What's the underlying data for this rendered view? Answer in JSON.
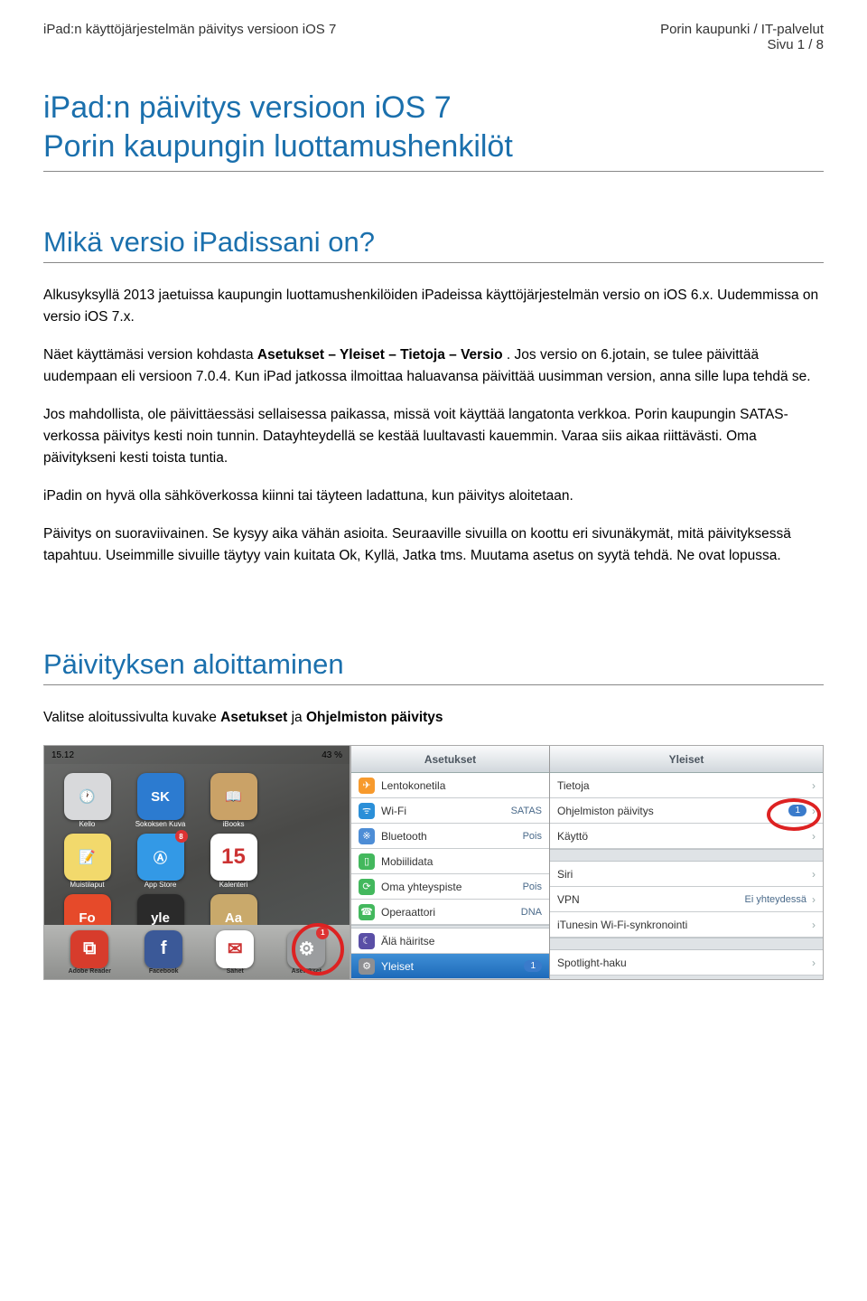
{
  "header": {
    "left": "iPad:n käyttöjärjestelmän päivitys versioon iOS 7",
    "right1": "Porin kaupunki / IT-palvelut",
    "right2": "Sivu 1 / 8"
  },
  "title1": "iPad:n päivitys versioon iOS 7",
  "title2": "Porin kaupungin luottamushenkilöt",
  "section1_title": "Mikä versio iPadissani on?",
  "p1a": "Alkusyksyllä 2013 jaetuissa kaupungin luottamushenkilöiden iPadeissa käyttöjärjestelmän versio on iOS 6.x. Uudemmissa on versio iOS 7.x.",
  "p1b_prefix": "Näet käyttämäsi version kohdasta ",
  "p1b_bold": "Asetukset – Yleiset – Tietoja – Versio",
  "p1b_suffix": ". Jos versio on 6.jotain, se tulee päivittää uudempaan eli versioon 7.0.4. Kun iPad jatkossa ilmoittaa haluavansa päivittää uusimman version, anna sille lupa tehdä se.",
  "p2": "Jos mahdollista, ole päivittäessäsi sellaisessa paikassa, missä voit käyttää langatonta verkkoa. Porin kaupungin SATAS-verkossa päivitys kesti noin tunnin. Datayhteydellä se kestää luultavasti kauemmin. Varaa siis aikaa riittävästi. Oma päivitykseni kesti toista tuntia.",
  "p3": "iPadin on hyvä olla sähköverkossa kiinni tai täyteen ladattuna, kun päivitys aloitetaan.",
  "p4": "Päivitys on suoraviivainen. Se kysyy aika vähän asioita. Seuraaville sivuilla on koottu eri sivunäkymät, mitä päivityksessä tapahtuu. Useimmille sivuille täytyy vain kuitata Ok, Kyllä, Jatka tms. Muutama asetus on syytä tehdä. Ne ovat lopussa.",
  "section2_title": "Päivityksen aloittaminen",
  "p5_prefix": "Valitse aloitussivulta kuvake ",
  "p5_bold1": "Asetukset",
  "p5_mid": " ja ",
  "p5_bold2": "Ohjelmiston päivitys",
  "home": {
    "time": "15.12",
    "batt": "43 %",
    "apps": [
      "Kello",
      "Sokoksen Kuva",
      "iBooks",
      "",
      "Muistilaput",
      "App Store",
      "Kalenteri",
      "",
      "Fonecta",
      "Yle Areena",
      "Dictionary",
      ""
    ],
    "cal": "15",
    "dock": [
      "Adobe Reader",
      "Facebook",
      "Sähet",
      "Asetukset"
    ],
    "badge_appstore": "8",
    "badge_settings": "1"
  },
  "settings": {
    "left_title": "Asetukset",
    "right_title": "Yleiset",
    "left_items": [
      {
        "icon": "✈︎",
        "bg": "#f79a2d",
        "label": "Lentokonetila",
        "val": ""
      },
      {
        "icon": "ᯤ",
        "bg": "#2b8fd8",
        "label": "Wi-Fi",
        "val": "SATAS"
      },
      {
        "icon": "※",
        "bg": "#4d8dd6",
        "label": "Bluetooth",
        "val": "Pois"
      },
      {
        "icon": "▯",
        "bg": "#43b85d",
        "label": "Mobiilidata",
        "val": ""
      },
      {
        "icon": "⟳",
        "bg": "#43b85d",
        "label": "Oma yhteyspiste",
        "val": "Pois"
      },
      {
        "icon": "☎",
        "bg": "#43b85d",
        "label": "Operaattori",
        "val": "DNA"
      }
    ],
    "left_items2": [
      {
        "icon": "☾",
        "bg": "#5a4fa6",
        "label": "Älä häiritse",
        "val": ""
      },
      {
        "icon": "⚙",
        "bg": "#8e8f92",
        "label": "Yleiset",
        "badge": "1",
        "selected": true
      }
    ],
    "right_items": [
      {
        "label": "Tietoja"
      },
      {
        "label": "Ohjelmiston päivitys",
        "badge": "1"
      },
      {
        "label": "Käyttö"
      }
    ],
    "right_items2": [
      {
        "label": "Siri"
      },
      {
        "label": "VPN",
        "val": "Ei yhteydessä"
      },
      {
        "label": "iTunesin Wi-Fi-synkronointi"
      }
    ],
    "right_items3": [
      {
        "label": "Spotlight-haku"
      }
    ]
  }
}
